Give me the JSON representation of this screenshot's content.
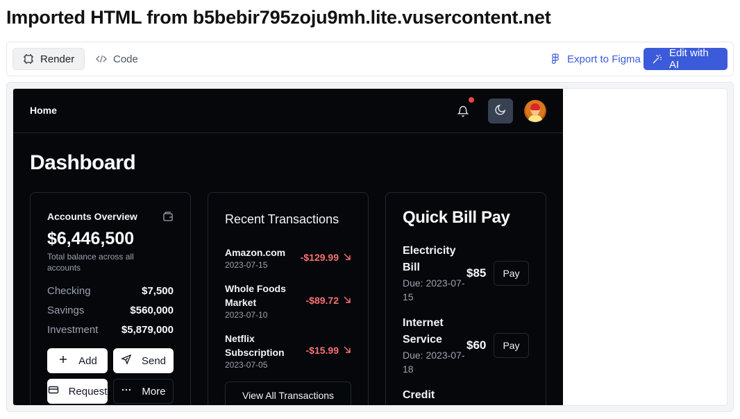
{
  "page": {
    "title": "Imported HTML from b5bebir795zoju9mh.lite.vusercontent.net"
  },
  "toolbar": {
    "render_label": "Render",
    "code_label": "Code",
    "figma_label": "Export to Figma",
    "ai_label": "Edit with AI",
    "accent": "#3b5bdb"
  },
  "app": {
    "header": {
      "home": "Home",
      "notification_dot": true
    },
    "title": "Dashboard",
    "accounts": {
      "title": "Accounts Overview",
      "total": "$6,446,500",
      "subtitle": "Total balance across all accounts",
      "rows": [
        {
          "label": "Checking",
          "value": "$7,500"
        },
        {
          "label": "Savings",
          "value": "$560,000"
        },
        {
          "label": "Investment",
          "value": "$5,879,000"
        }
      ],
      "actions": [
        "Add",
        "Send",
        "Request",
        "More"
      ]
    },
    "transactions": {
      "title": "Recent Transactions",
      "items": [
        {
          "name": "Amazon.com",
          "date": "2023-07-15",
          "amount": "-$129.99"
        },
        {
          "name": "Whole Foods Market",
          "date": "2023-07-10",
          "amount": "-$89.72"
        },
        {
          "name": "Netflix Subscription",
          "date": "2023-07-05",
          "amount": "-$15.99"
        }
      ],
      "view_all": "View All Transactions",
      "negative_color": "#f87171"
    },
    "bills": {
      "title": "Quick Bill Pay",
      "pay_label": "Pay",
      "items": [
        {
          "name": "Electricity Bill",
          "due": "Due: 2023-07-15",
          "amount": "$85"
        },
        {
          "name": "Internet Service",
          "due": "Due: 2023-07-18",
          "amount": "$60"
        },
        {
          "name": "Credit",
          "due": "",
          "amount": ""
        }
      ]
    }
  }
}
